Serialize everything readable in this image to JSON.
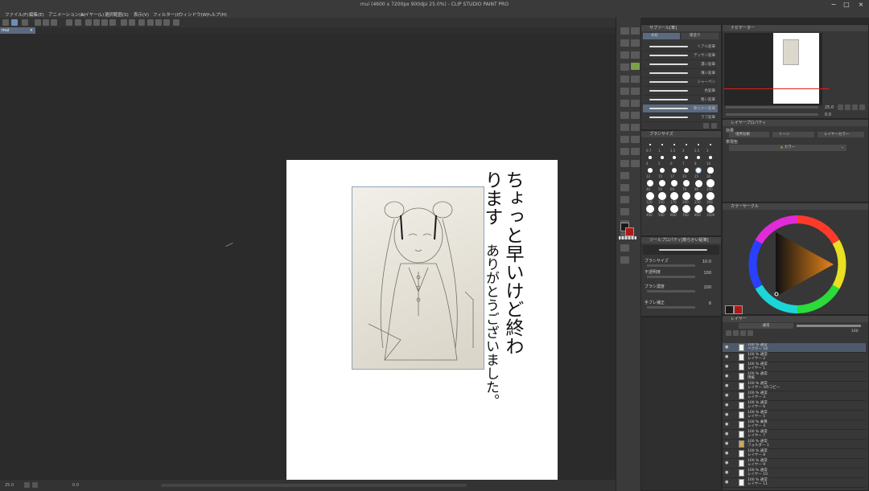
{
  "window": {
    "title": "mui (4600 x 7200px 900dpi 25.0%) - CLIP STUDIO PAINT PRO",
    "minimize": "−",
    "maximize": "□",
    "close": "×"
  },
  "menu": [
    {
      "label": "ファイル(F)",
      "icon": "menu-file"
    },
    {
      "label": "編集(E)",
      "icon": "menu-edit"
    },
    {
      "label": "アニメーション(A)",
      "icon": "menu-animation"
    },
    {
      "label": "レイヤー(L)",
      "icon": "menu-layer"
    },
    {
      "label": "選択範囲(S)",
      "icon": "menu-selection"
    },
    {
      "label": "表示(V)",
      "icon": "menu-view"
    },
    {
      "label": "フィルター(I)",
      "icon": "menu-filter"
    },
    {
      "label": "ウィンドウ(W)",
      "icon": "menu-window"
    },
    {
      "label": "ヘルプ(H)",
      "icon": "menu-help"
    }
  ],
  "document_tab": {
    "label": "mui",
    "close": "×"
  },
  "canvas": {
    "handwritten_text_col1": "ちょっと早いけど終わります",
    "handwritten_text_col2": "ありがとうございました。",
    "zoom": "25.0",
    "rotation": "0.0"
  },
  "status": {
    "zoom": "25.0",
    "coords": "0.0"
  },
  "subtool_panel": {
    "title": "サブツール[筆]",
    "tabs": [
      "水彩",
      "厚塗り"
    ],
    "brushes": [
      {
        "name": "リアル鉛筆",
        "selected": false
      },
      {
        "name": "デッサン鉛筆",
        "selected": false
      },
      {
        "name": "濃い鉛筆",
        "selected": false
      },
      {
        "name": "薄い鉛筆",
        "selected": false
      },
      {
        "name": "シャーペン",
        "selected": false
      },
      {
        "name": "色鉛筆",
        "selected": false
      },
      {
        "name": "粗い鉛筆",
        "selected": false
      },
      {
        "name": "軟らかい鉛筆",
        "selected": true
      },
      {
        "name": "ラフ鉛筆",
        "selected": false
      }
    ]
  },
  "brush_size_panel": {
    "title": "ブラシサイズ",
    "sizes": [
      "0.7",
      "1",
      "1.5",
      "2",
      "2.5",
      "3",
      "4",
      "5",
      "6",
      "7",
      "8",
      "10",
      "12",
      "15",
      "17",
      "20",
      "25",
      "30",
      "40",
      "50",
      "60",
      "70",
      "80",
      "100",
      "120",
      "150",
      "170",
      "200",
      "250",
      "300",
      "400",
      "500",
      "600",
      "700",
      "800",
      "1000"
    ]
  },
  "tool_property_panel": {
    "title": "ツールプロパティ[軟らかい鉛筆]",
    "rows": [
      {
        "label": "ブラシサイズ",
        "value": "10.0"
      },
      {
        "label": "不透明度",
        "value": "100"
      },
      {
        "label": "ブラシ濃度",
        "value": "100"
      },
      {
        "label": "手ブレ補正",
        "value": "6"
      }
    ]
  },
  "navigator": {
    "title": "ナビゲーター",
    "zoom": "25.0",
    "rotation": "0.0"
  },
  "layer_property": {
    "title": "レイヤープロパティ",
    "effect_label": "効果",
    "border_effect": "境界効果",
    "tone": "トーン",
    "layer_color": "レイヤーカラー",
    "expression_color_label": "表現色",
    "expression_color": "カラー"
  },
  "color_wheel": {
    "title": "カラーサークル",
    "main_color": "#1a1a1a",
    "sub_color": "#b01818",
    "hue_hex": "#e8861a"
  },
  "layer_panel": {
    "title": "レイヤー",
    "blend_mode": "通常",
    "opacity": "100",
    "layers": [
      {
        "name": "ベクター 18",
        "sub": "100 % 通常",
        "selected": true,
        "folder": false
      },
      {
        "name": "レイヤー 2",
        "sub": "100 % 通常",
        "selected": false,
        "folder": false
      },
      {
        "name": "レイヤー 1",
        "sub": "100 % 通常",
        "selected": false,
        "folder": false
      },
      {
        "name": "用紙",
        "sub": "100 % 通常",
        "selected": false,
        "folder": false
      },
      {
        "name": "レイヤー 3のコピー",
        "sub": "100 % 通常",
        "selected": false,
        "folder": false
      },
      {
        "name": "レイヤー 3",
        "sub": "100 % 通常",
        "selected": false,
        "folder": false
      },
      {
        "name": "レイヤー 6",
        "sub": "100 % 通常",
        "selected": false,
        "folder": false
      },
      {
        "name": "レイヤー 5",
        "sub": "100 % 通常",
        "selected": false,
        "folder": false
      },
      {
        "name": "レイヤー 4",
        "sub": "100 % 乗算",
        "selected": false,
        "folder": false
      },
      {
        "name": "レイヤー 7",
        "sub": "100 % 通常",
        "selected": false,
        "folder": false
      },
      {
        "name": "フォルダー 1",
        "sub": "100 % 通常",
        "selected": false,
        "folder": true
      },
      {
        "name": "レイヤー 8",
        "sub": "100 % 通常",
        "selected": false,
        "folder": false
      },
      {
        "name": "レイヤー 9",
        "sub": "100 % 通常",
        "selected": false,
        "folder": false
      },
      {
        "name": "レイヤー 10",
        "sub": "100 % 通常",
        "selected": false,
        "folder": false
      },
      {
        "name": "レイヤー 11",
        "sub": "100 % 通常",
        "selected": false,
        "folder": false
      }
    ]
  }
}
